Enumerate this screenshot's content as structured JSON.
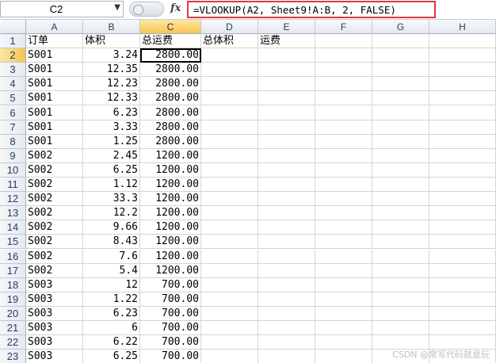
{
  "name_box": "C2",
  "fx": "fx",
  "formula": "=VLOOKUP(A2, Sheet9!A:B, 2, FALSE)",
  "columns": [
    "A",
    "B",
    "C",
    "D",
    "E",
    "F",
    "G",
    "H"
  ],
  "selected_column": "C",
  "selected_row": "2",
  "rows": [
    {
      "n": "1",
      "A": "订单",
      "B": "体积",
      "C": "总运费",
      "D": "总体积",
      "E": "运费"
    },
    {
      "n": "2",
      "A": "S001",
      "B": "3.24",
      "C": "2800.00"
    },
    {
      "n": "3",
      "A": "S001",
      "B": "12.35",
      "C": "2800.00"
    },
    {
      "n": "4",
      "A": "S001",
      "B": "12.23",
      "C": "2800.00"
    },
    {
      "n": "5",
      "A": "S001",
      "B": "12.33",
      "C": "2800.00"
    },
    {
      "n": "6",
      "A": "S001",
      "B": "6.23",
      "C": "2800.00"
    },
    {
      "n": "7",
      "A": "S001",
      "B": "3.33",
      "C": "2800.00"
    },
    {
      "n": "8",
      "A": "S001",
      "B": "1.25",
      "C": "2800.00"
    },
    {
      "n": "9",
      "A": "S002",
      "B": "2.45",
      "C": "1200.00"
    },
    {
      "n": "10",
      "A": "S002",
      "B": "6.25",
      "C": "1200.00"
    },
    {
      "n": "11",
      "A": "S002",
      "B": "1.12",
      "C": "1200.00"
    },
    {
      "n": "12",
      "A": "S002",
      "B": "33.3",
      "C": "1200.00"
    },
    {
      "n": "13",
      "A": "S002",
      "B": "12.2",
      "C": "1200.00"
    },
    {
      "n": "14",
      "A": "S002",
      "B": "9.66",
      "C": "1200.00"
    },
    {
      "n": "15",
      "A": "S002",
      "B": "8.43",
      "C": "1200.00"
    },
    {
      "n": "16",
      "A": "S002",
      "B": "7.6",
      "C": "1200.00"
    },
    {
      "n": "17",
      "A": "S002",
      "B": "5.4",
      "C": "1200.00"
    },
    {
      "n": "18",
      "A": "S003",
      "B": "12",
      "C": "700.00"
    },
    {
      "n": "19",
      "A": "S003",
      "B": "1.22",
      "C": "700.00"
    },
    {
      "n": "20",
      "A": "S003",
      "B": "6.23",
      "C": "700.00"
    },
    {
      "n": "21",
      "A": "S003",
      "B": "6",
      "C": "700.00"
    },
    {
      "n": "22",
      "A": "S003",
      "B": "6.22",
      "C": "700.00"
    },
    {
      "n": "23",
      "A": "S003",
      "B": "6.25",
      "C": "700.00"
    }
  ],
  "watermark": "CSDN @常写代码就是玩"
}
